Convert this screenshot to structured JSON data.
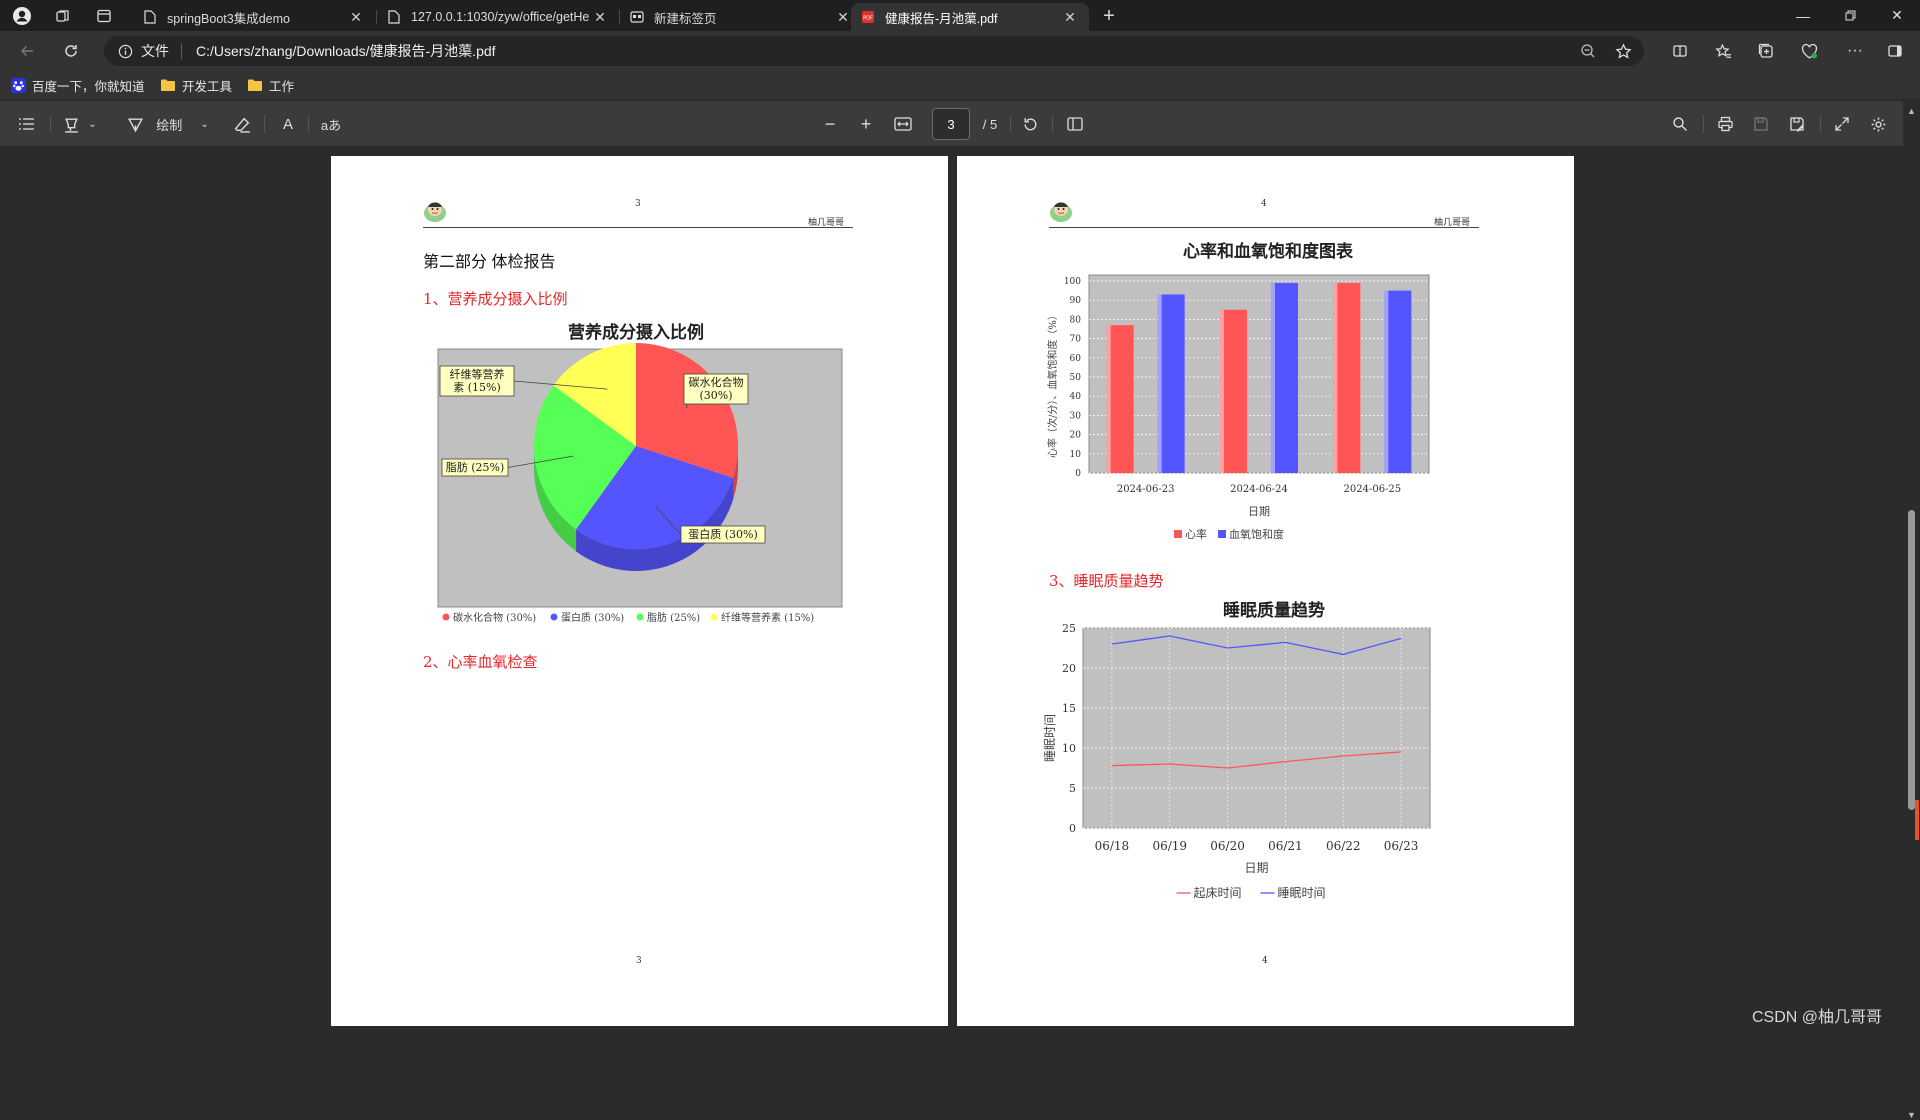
{
  "browser": {
    "tabs": [
      {
        "title": "springBoot3集成demo",
        "active": false
      },
      {
        "title": "127.0.0.1:1030/zyw/office/getHe",
        "active": false
      },
      {
        "title": "新建标签页",
        "active": false
      },
      {
        "title": "健康报告-月池蕖.pdf",
        "active": true
      }
    ],
    "security_label": "文件",
    "url": "C:/Users/zhang/Downloads/健康报告-月池蕖.pdf"
  },
  "bookmarks": [
    {
      "label": "百度一下，你就知道",
      "icon": "baidu-icon"
    },
    {
      "label": "开发工具",
      "icon": "folder-icon"
    },
    {
      "label": "工作",
      "icon": "folder-icon"
    }
  ],
  "pdf_toolbar": {
    "draw_label": "绘制",
    "page_current": "3",
    "page_total": "/ 5",
    "font_glyph_a": "A",
    "lang_glyph": "aあ"
  },
  "page3": {
    "header_page": "3",
    "author": "柚几哥哥",
    "section_title": "第二部分 体检报告",
    "h1": "1、营养成分摄入比例",
    "h2": "2、心率血氧检查",
    "footer_page": "3"
  },
  "page4": {
    "header_page": "4",
    "author": "柚几哥哥",
    "h3": "3、睡眠质量趋势",
    "footer_page": "4"
  },
  "chart_data": [
    {
      "type": "pie",
      "title": "营养成分摄入比例",
      "categories": [
        "碳水化合物",
        "蛋白质",
        "脂肪",
        "纤维等营养素"
      ],
      "values": [
        30,
        30,
        25,
        15
      ],
      "slice_labels": [
        "碳水化合物\n(30%)",
        "蛋白质 (30%)",
        "脂肪 (25%)",
        "纤维等营养\n素 (15%)"
      ],
      "legend": [
        "碳水化合物 (30%)",
        "蛋白质 (30%)",
        "脂肪 (25%)",
        "纤维等营养素 (15%)"
      ],
      "colors": [
        "#ff5555",
        "#5555ff",
        "#55ff55",
        "#ffff55"
      ],
      "legend_position": "bottom"
    },
    {
      "type": "bar",
      "title": "心率和血氧饱和度图表",
      "categories": [
        "2024-06-23",
        "2024-06-24",
        "2024-06-25"
      ],
      "series": [
        {
          "name": "心率",
          "values": [
            77,
            85,
            99
          ],
          "color": "#ff5555"
        },
        {
          "name": "血氧饱和度",
          "values": [
            93,
            99,
            95
          ],
          "color": "#5555ff"
        }
      ],
      "xlabel": "日期",
      "ylabel": "心率（次/分）、血氧饱和度（%）",
      "ylim": [
        0,
        100
      ],
      "yticks": [
        0,
        10,
        20,
        30,
        40,
        50,
        60,
        70,
        80,
        90,
        100
      ],
      "grid": true,
      "legend_position": "bottom"
    },
    {
      "type": "line",
      "title": "睡眠质量趋势",
      "categories": [
        "06/18",
        "06/19",
        "06/20",
        "06/21",
        "06/22",
        "06/23"
      ],
      "series": [
        {
          "name": "起床时间",
          "values": [
            7.8,
            8.0,
            7.5,
            8.3,
            9.0,
            9.5
          ],
          "color": "#ff5555"
        },
        {
          "name": "睡眠时间",
          "values": [
            23.0,
            24.0,
            22.5,
            23.2,
            21.7,
            23.7
          ],
          "color": "#5555ff"
        }
      ],
      "xlabel": "日期",
      "ylabel": "睡眠时间",
      "ylim": [
        0,
        25
      ],
      "yticks": [
        0,
        5,
        10,
        15,
        20,
        25
      ],
      "grid": true,
      "legend_position": "bottom"
    }
  ],
  "watermark": "CSDN @柚几哥哥"
}
